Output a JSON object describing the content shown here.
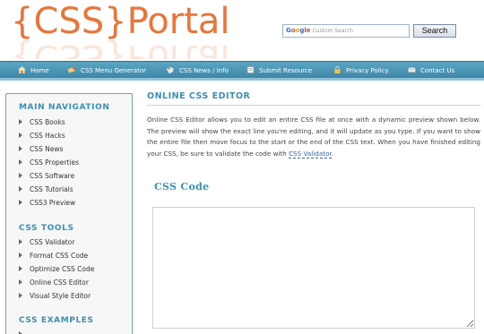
{
  "header": {
    "logo_text": "{CSS}Portal",
    "search_placeholder": "Custom Search",
    "search_google_letters": [
      "G",
      "o",
      "o",
      "g",
      "l",
      "e"
    ],
    "search_button_label": "Search"
  },
  "nav": {
    "items": [
      {
        "label": "Home",
        "icon": "home-icon"
      },
      {
        "label": "CSS Menu Generator",
        "icon": "paint-icon"
      },
      {
        "label": "CSS News / Info",
        "icon": "tag-icon"
      },
      {
        "label": "Submit Resource",
        "icon": "document-icon"
      },
      {
        "label": "Privacy Policy",
        "icon": "lock-icon"
      },
      {
        "label": "Contact Us",
        "icon": "mail-icon"
      }
    ]
  },
  "sidebar": {
    "main_navigation": {
      "heading": "MAIN NAVIGATION",
      "items": [
        "CSS Books",
        "CSS Hacks",
        "CSS News",
        "CSS Properties",
        "CSS Software",
        "CSS Tutorials",
        "CSS3 Preview"
      ]
    },
    "css_tools": {
      "heading": "CSS TOOLS",
      "items": [
        "CSS Validator",
        "Format CSS Code",
        "Optimize CSS Code",
        "Online CSS Editor",
        "Visual Style Editor"
      ]
    },
    "css_examples": {
      "heading": "CSS EXAMPLES"
    }
  },
  "main": {
    "title": "ONLINE CSS EDITOR",
    "intro_text": "Online CSS Editor allows you to edit an entire CSS file at once with a dynamic preview shown below. The preview will show the exact line you're editing, and it will update as you type. If you want to show the entire file then move focus to the start or the end of the CSS text. When you have finished editing your CSS, be sure to validate the code with ",
    "intro_link": "CSS Validator",
    "intro_end": ".",
    "section_title": "CSS Code",
    "code_value": ""
  },
  "colors": {
    "logo": "#e8753a",
    "accent": "#3a8fb6",
    "nav_bg": "#4b96b8",
    "link": "#3366aa"
  }
}
